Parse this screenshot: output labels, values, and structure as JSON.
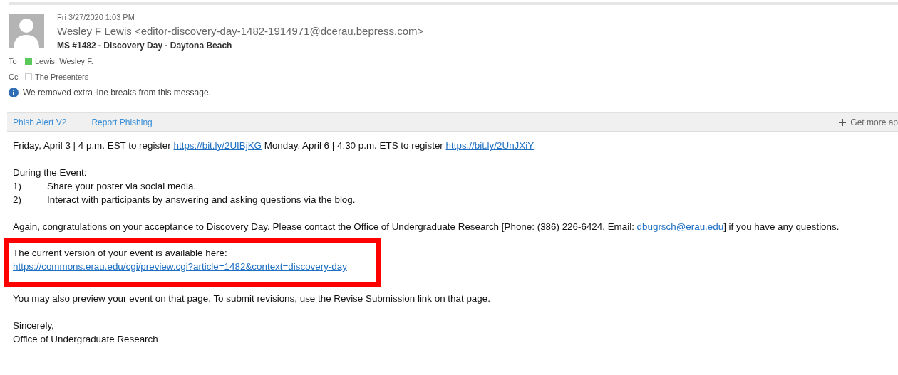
{
  "header": {
    "date": "Fri 3/27/2020 1:03 PM",
    "sender": "Wesley F Lewis <editor-discovery-day-1482-1914971@dcerau.bepress.com>",
    "subject": "MS #1482 - Discovery Day - Daytona Beach",
    "recipients": [
      {
        "label": "To",
        "name": "Lewis, Wesley F.",
        "color": "#5ac85a"
      },
      {
        "label": "Cc",
        "name": "The Presenters",
        "color": "#ffffff"
      }
    ],
    "notice": "We removed extra line breaks from this message."
  },
  "toolbar": {
    "items": [
      "Phish Alert V2",
      "Report Phishing"
    ],
    "get_more": "Get more ap"
  },
  "body": [
    {
      "kind": "para",
      "highlighted": false,
      "lines": [
        [
          {
            "text": "Friday, April 3 | 4 p.m. EST to register "
          },
          {
            "text": "https://bit.ly/2UIBjKG",
            "link": true
          },
          {
            "text": " Monday, April 6 | 4:30 p.m. ETS to register "
          },
          {
            "text": "https://bit.ly/2UnJXiY",
            "link": true
          }
        ]
      ]
    },
    {
      "kind": "list",
      "highlighted": false,
      "title": "During the Event:",
      "items": [
        {
          "number": "1)",
          "text": "Share your poster via social media."
        },
        {
          "number": "2)",
          "text": "Interact with participants by answering and asking questions via the blog."
        }
      ]
    },
    {
      "kind": "para",
      "highlighted": false,
      "lines": [
        [
          {
            "text": "Again, congratulations on your acceptance to Discovery Day. Please contact the Office of Undergraduate Research [Phone: (386) 226-6424, Email: "
          },
          {
            "text": "dbugrsch@erau.edu",
            "link": true
          },
          {
            "text": "] if you have any questions."
          }
        ]
      ]
    },
    {
      "kind": "para",
      "highlighted": true,
      "lines": [
        [
          {
            "text": "The current version of your event is available here:"
          }
        ],
        [
          {
            "text": "https://commons.erau.edu/cgi/preview.cgi?article=1482&context=discovery-day",
            "link": true
          }
        ]
      ]
    },
    {
      "kind": "para",
      "highlighted": false,
      "lines": [
        [
          {
            "text": "You may also preview your event on that page. To submit revisions, use the Revise Submission link on that page."
          }
        ]
      ]
    },
    {
      "kind": "para",
      "highlighted": false,
      "lines": [
        [
          {
            "text": "Sincerely,"
          }
        ],
        [
          {
            "text": "Office of Undergraduate Research"
          }
        ]
      ]
    }
  ]
}
